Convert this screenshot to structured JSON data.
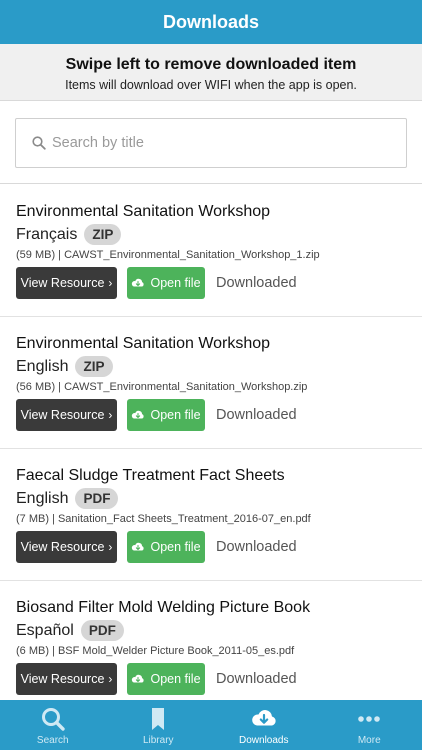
{
  "header": {
    "title": "Downloads"
  },
  "notice": {
    "headline": "Swipe left to remove downloaded item",
    "subline": "Items will download over WIFI when the app is open."
  },
  "search": {
    "placeholder": "Search by title",
    "value": ""
  },
  "items": [
    {
      "title": "Environmental Sanitation Workshop",
      "language": "Français",
      "format": "ZIP",
      "file": "(59 MB) | CAWST_Environmental_Sanitation_Workshop_1.zip",
      "view_label": "View Resource",
      "open_label": "Open file",
      "status": "Downloaded"
    },
    {
      "title": "Environmental Sanitation Workshop",
      "language": "English",
      "format": "ZIP",
      "file": "(56 MB) | CAWST_Environmental_Sanitation_Workshop.zip",
      "view_label": "View Resource",
      "open_label": "Open file",
      "status": "Downloaded"
    },
    {
      "title": "Faecal Sludge Treatment Fact Sheets",
      "language": "English",
      "format": "PDF",
      "file": "(7 MB) | Sanitation_Fact Sheets_Treatment_2016-07_en.pdf",
      "view_label": "View Resource",
      "open_label": "Open file",
      "status": "Downloaded"
    },
    {
      "title": "Biosand Filter Mold Welding Picture Book",
      "language": "Español",
      "format": "PDF",
      "file": "(6 MB) | BSF Mold_Welder Picture Book_2011-05_es.pdf",
      "view_label": "View Resource",
      "open_label": "Open file",
      "status": "Downloaded"
    }
  ],
  "tabs": [
    {
      "label": "Search",
      "icon": "search-icon",
      "active": false
    },
    {
      "label": "Library",
      "icon": "bookmark-icon",
      "active": false
    },
    {
      "label": "Downloads",
      "icon": "cloud-download-icon",
      "active": true
    },
    {
      "label": "More",
      "icon": "more-dots-icon",
      "active": false
    }
  ],
  "colors": {
    "primary": "#2a9bc8",
    "open_button": "#4db35b",
    "view_button": "#3a3a3a",
    "badge": "#d6d6d6"
  }
}
